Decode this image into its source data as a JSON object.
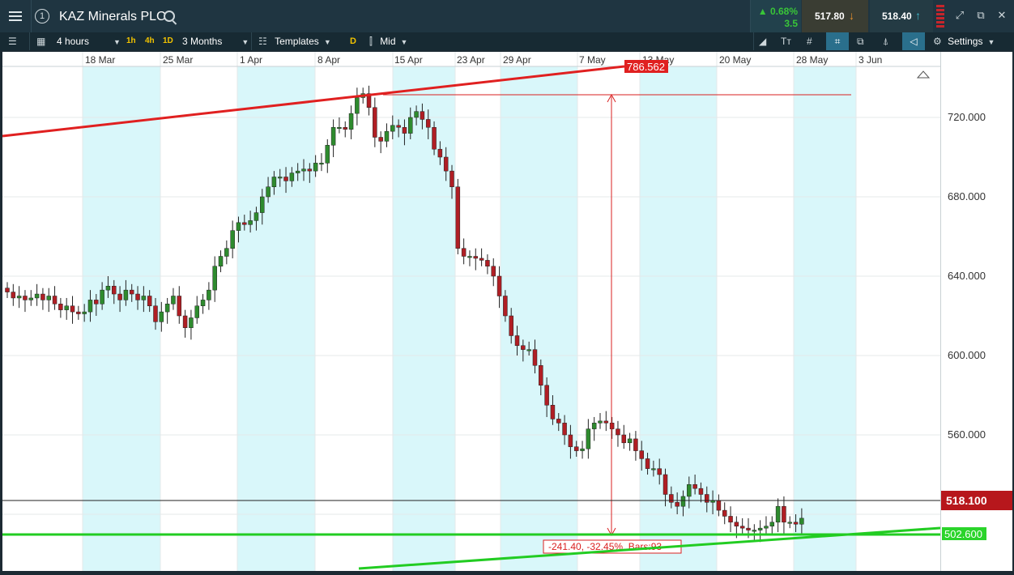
{
  "header": {
    "title": "KAZ Minerals PLC",
    "change_pct": "▲ 0.68%",
    "change_abs": "3.5",
    "sell_price": "517.80",
    "buy_price": "518.40",
    "circle_label": "1"
  },
  "toolbar": {
    "interval": "4 hours",
    "quick_1h": "1h",
    "quick_4h": "4h",
    "quick_1d": "1D",
    "range": "3 Months",
    "templates": "Templates",
    "d_button": "D",
    "price_type": "Mid",
    "settings": "Settings"
  },
  "colors": {
    "up": "#2e8b2e",
    "down": "#b01e24",
    "band": "#d9f7fa",
    "trend_red": "#e02020",
    "trend_green": "#22cc22"
  },
  "chart_data": {
    "type": "candlestick",
    "instrument": "KAZ Minerals PLC",
    "interval": "4 hours",
    "range": "3 Months",
    "ylim": [
      496,
      740
    ],
    "yticks": [
      520,
      560,
      600,
      640,
      680,
      720
    ],
    "ytick_labels": [
      "520.000",
      "560.000",
      "600.000",
      "640.000",
      "680.000",
      "720.000"
    ],
    "x_labels": [
      "18 Mar",
      "25 Mar",
      "1 Apr",
      "8 Apr",
      "15 Apr",
      "23 Apr",
      "29 Apr",
      "7 May",
      "13 May",
      "20 May",
      "28 May",
      "3 Jun"
    ],
    "current_price": 518.1,
    "current_price_label": "518.100",
    "support_level": 502.6,
    "support_label": "502.600",
    "trendline_label": "786.562",
    "measure_label": "-241.40, -32.45%, Bars:93",
    "closes": [
      632,
      629,
      630,
      628,
      629,
      631,
      628,
      630,
      626,
      623,
      625,
      622,
      621,
      622,
      628,
      626,
      633,
      635,
      631,
      628,
      633,
      631,
      628,
      630,
      625,
      617,
      622,
      626,
      630,
      620,
      614,
      619,
      625,
      628,
      633,
      645,
      650,
      654,
      663,
      667,
      666,
      668,
      672,
      680,
      685,
      690,
      690,
      688,
      692,
      693,
      694,
      693,
      697,
      697,
      706,
      715,
      715,
      714,
      722,
      730,
      732,
      725,
      710,
      708,
      713,
      716,
      715,
      712,
      720,
      723,
      719,
      715,
      704,
      700,
      693,
      685,
      654,
      650,
      650,
      649,
      648,
      645,
      640,
      630,
      620,
      610,
      605,
      603,
      603,
      595,
      585,
      575,
      568,
      566,
      560,
      554,
      552,
      553,
      563,
      566,
      567,
      566,
      563,
      560,
      556,
      558,
      552,
      548,
      543,
      543,
      540,
      530,
      526,
      524,
      529,
      535,
      533,
      530,
      526,
      527,
      522,
      519,
      516,
      514,
      513,
      512,
      512,
      513,
      514,
      516,
      524,
      516,
      516,
      515,
      518
    ]
  }
}
